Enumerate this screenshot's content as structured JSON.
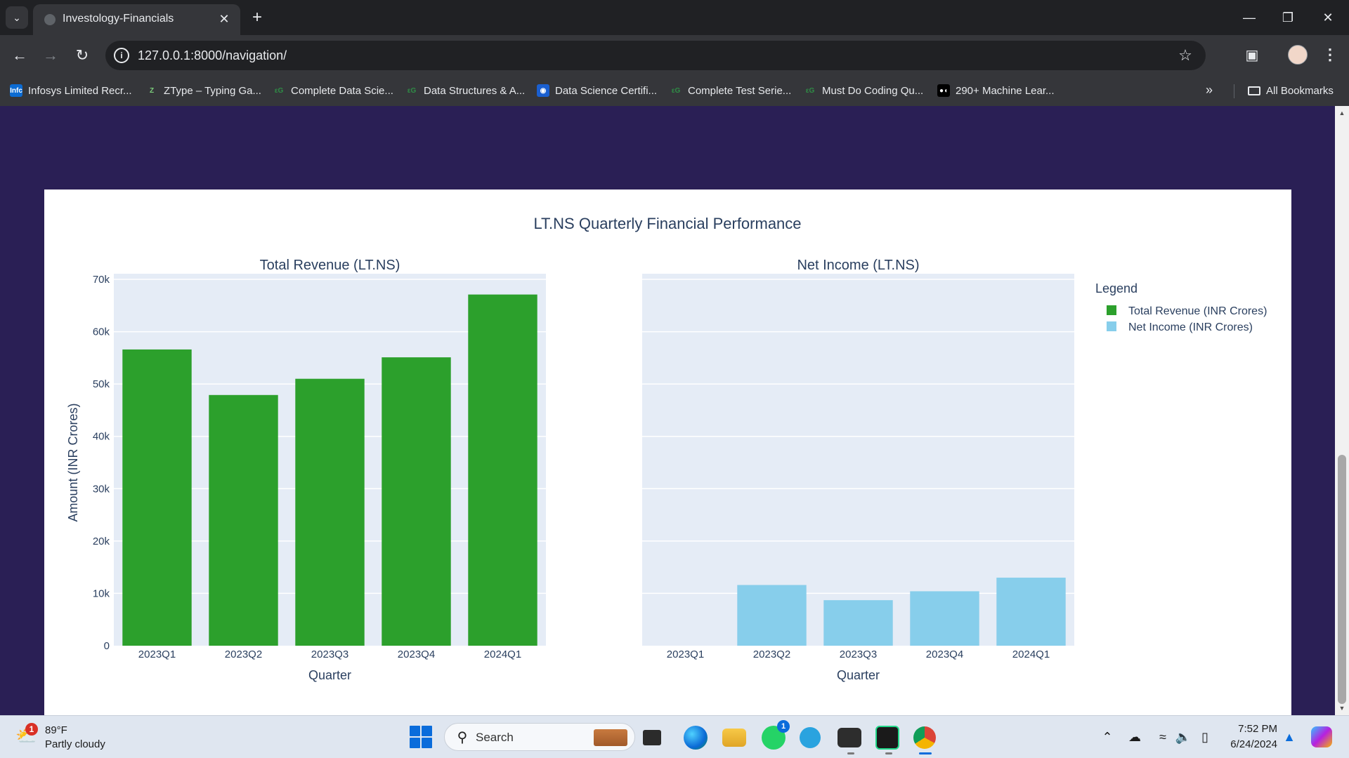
{
  "browser": {
    "tab_title": "Investology-Financials",
    "url": "127.0.0.1:8000/navigation/",
    "bookmarks": [
      {
        "label": "Infosys Limited Recr...",
        "icon": "infosys-icon",
        "color": "#0b6bd3",
        "glyph": "Infc"
      },
      {
        "label": "ZType – Typing Ga...",
        "icon": "ztype-icon",
        "color": "#35363a",
        "glyph": "Z"
      },
      {
        "label": "Complete Data Scie...",
        "icon": "gfg-icon",
        "color": "#35363a",
        "glyph": "εG"
      },
      {
        "label": "Data Structures & A...",
        "icon": "gfg-icon",
        "color": "#35363a",
        "glyph": "εG"
      },
      {
        "label": "Data Science Certifi...",
        "icon": "certification-icon",
        "color": "#1a5fd0",
        "glyph": "◉"
      },
      {
        "label": "Complete Test Serie...",
        "icon": "gfg-icon",
        "color": "#35363a",
        "glyph": "εG"
      },
      {
        "label": "Must Do Coding Qu...",
        "icon": "gfg-icon",
        "color": "#35363a",
        "glyph": "εG"
      },
      {
        "label": "290+ Machine Lear...",
        "icon": "medium-icon",
        "color": "#000000",
        "glyph": "●◖"
      }
    ],
    "all_bookmarks_label": "All Bookmarks"
  },
  "chart_data": {
    "type": "bar",
    "title": "LT.NS Quarterly Financial Performance",
    "ylabel": "Amount (INR Crores)",
    "ylim": [
      0,
      70000
    ],
    "yticks": [
      0,
      10000,
      20000,
      30000,
      40000,
      50000,
      60000,
      70000
    ],
    "ytick_labels": [
      "0",
      "10k",
      "20k",
      "30k",
      "40k",
      "50k",
      "60k",
      "70k"
    ],
    "grid": true,
    "legend": {
      "title": "Legend",
      "position": "top-right"
    },
    "categories": [
      "2023Q1",
      "2023Q2",
      "2023Q3",
      "2023Q4",
      "2024Q1"
    ],
    "subplots": [
      {
        "subtitle": "Total Revenue (LT.NS)",
        "xlabel": "Quarter",
        "series": [
          {
            "name": "Total Revenue (INR Crores)",
            "color": "#2ca02c",
            "values": [
              56600,
              47900,
              51000,
              55100,
              67100
            ]
          }
        ]
      },
      {
        "subtitle": "Net Income (LT.NS)",
        "xlabel": "Quarter",
        "series": [
          {
            "name": "Net Income (INR Crores)",
            "color": "#87ceeb",
            "values": [
              0,
              11600,
              8700,
              10400,
              13000
            ]
          }
        ]
      }
    ]
  },
  "taskbar": {
    "weather_temp": "89°F",
    "weather_desc": "Partly cloudy",
    "weather_badge": "1",
    "search_label": "Search",
    "whatsapp_badge": "1",
    "time": "7:52 PM",
    "date": "6/24/2024"
  }
}
